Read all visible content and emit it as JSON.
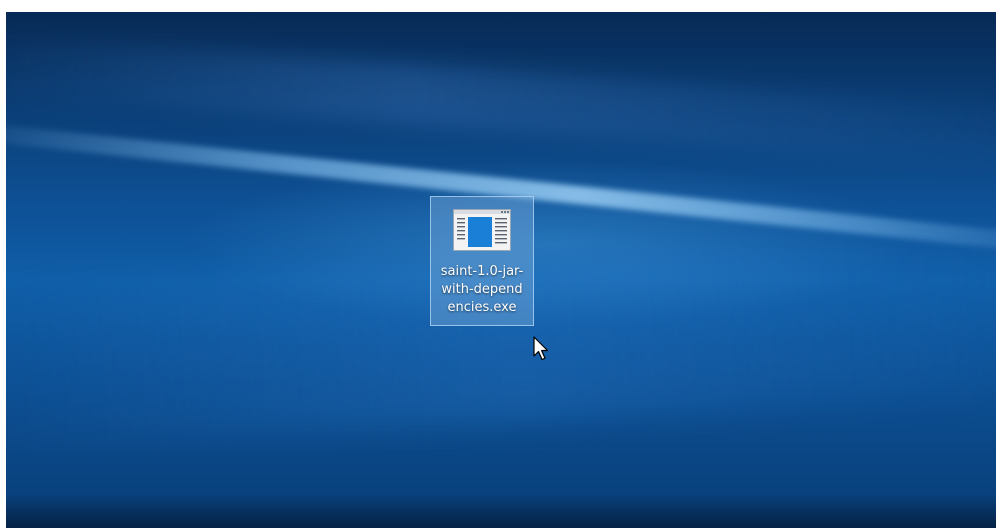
{
  "desktop": {
    "icon": {
      "label_lines": [
        "saint-1.0-jar-",
        "with-depend",
        "encies.exe"
      ],
      "icon_name": "exe-app-icon",
      "selected": true
    },
    "cursor": "mouse-pointer-icon"
  },
  "colors": {
    "accent": "#1a7fd6",
    "selection_fill": "#78aadc",
    "selection_border": "#b4d7f5"
  }
}
